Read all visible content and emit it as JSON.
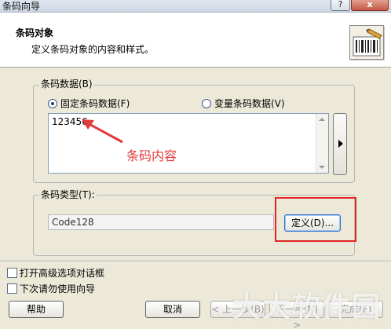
{
  "window": {
    "title": "条码向导",
    "help_glyph": "?",
    "close_glyph": "x"
  },
  "header": {
    "title": "条码对象",
    "subtitle": "定义条码对象的内容和样式。",
    "icon": "barcode-wizard-icon"
  },
  "barcode_data": {
    "group_label": "条码数据(B)",
    "radio_fixed": "固定条码数据(F)",
    "radio_variable": "变量条码数据(V)",
    "selected": "fixed",
    "value": "123456"
  },
  "annotation": {
    "text": "条码内容",
    "color": "#e13b3b"
  },
  "barcode_type": {
    "group_label": "条码类型(T):",
    "value": "Code128",
    "define_label": "定义(D)..."
  },
  "options": {
    "advanced_dialog": "打开高级选项对话框",
    "dont_use_wizard": "下次请勿使用向导"
  },
  "footer": {
    "help": "帮助",
    "cancel": "取消",
    "prev": "< 上一步(B)",
    "next": "下一步(N) >",
    "finish": "完成(F)"
  },
  "watermark": "大大软件园"
}
